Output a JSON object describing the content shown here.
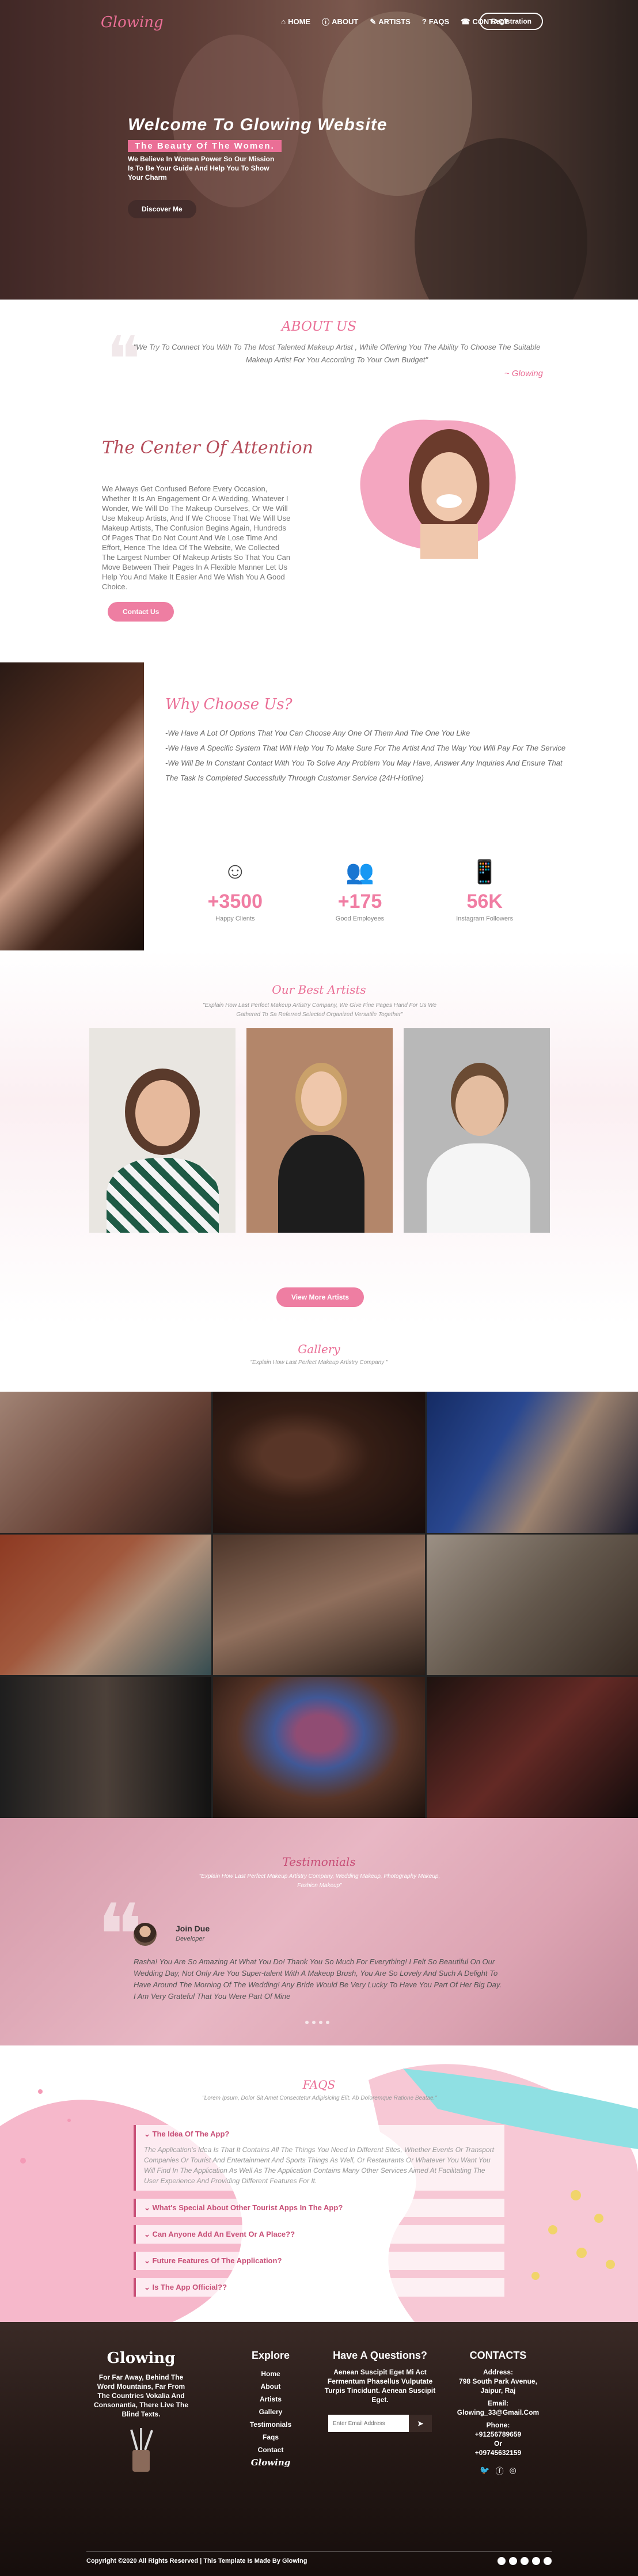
{
  "nav": {
    "logo": "Glowing",
    "items": [
      {
        "icon": "home-icon",
        "glyph": "⌂",
        "label": "HOME"
      },
      {
        "icon": "info-icon",
        "glyph": "ⓘ",
        "label": "ABOUT"
      },
      {
        "icon": "brush-icon",
        "glyph": "✎",
        "label": "ARTISTS"
      },
      {
        "icon": "question-icon",
        "glyph": "?",
        "label": "FAQS"
      },
      {
        "icon": "contact-icon",
        "glyph": "☎",
        "label": "CONTACT"
      }
    ],
    "registration": "Registration"
  },
  "hero": {
    "title": "Welcome To Glowing Website",
    "tagline": "The Beauty Of The Women.",
    "subtitle": "We Believe In Women Power So Our Mission Is To Be Your Guide And Help You To Show Your Charm",
    "button": "Discover Me"
  },
  "about": {
    "title": "ABOUT US",
    "quote": "\"We Try To Connect You With To The Most Talented Makeup Artist , While Offering You The Ability To Choose The Suitable Makeup Artist For You According To Your Own Budget\"",
    "quote_by": "~ Glowing"
  },
  "center": {
    "title": "The Center Of Attention",
    "text": "We Always Get Confused Before Every Occasion, Whether It Is An Engagement Or A Wedding, Whatever I Wonder, We Will Do The Makeup Ourselves, Or We Will Use Makeup Artists, And If We Choose That We Will Use Makeup Artists, The Confusion Begins Again, Hundreds Of Pages That Do Not Count And We Lose Time And Effort, Hence The Idea Of The Website, We Collected The Largest Number Of Makeup Artists So That You Can Move Between Their Pages In A Flexible Manner Let Us Help You And Make It Easier And We Wish You A Good Choice.",
    "button": "Contact Us"
  },
  "why": {
    "title": "Why Choose Us?",
    "points": [
      "-We Have A Lot Of Options That You Can Choose Any One Of Them And The One You Like",
      "-We Have A Specific System That Will Help You To Make Sure For The Artist And The Way You Will Pay For The Service",
      "-We Will Be In Constant Contact With You To Solve Any Problem You May Have, Answer Any Inquiries And Ensure That The Task Is Completed Successfully Through Customer Service (24H-Hotline)"
    ],
    "stats": [
      {
        "icon": "happy-clients-icon",
        "glyph": "☺",
        "value": "+3500",
        "label": "Happy Clients"
      },
      {
        "icon": "employees-icon",
        "glyph": "👥",
        "value": "+175",
        "label": "Good Employees"
      },
      {
        "icon": "instagram-icon",
        "glyph": "📱",
        "value": "56K",
        "label": "Instagram Followers"
      }
    ]
  },
  "artists": {
    "title": "Our Best Artists",
    "subtitle": "\"Explain How Last Perfect Makeup Artistry Company, We Give Fine Pages Hand For Us We Gathered To Sa Referred Selected Organized Versatile Together\"",
    "button": "View More Artists"
  },
  "gallery": {
    "title": "Gallery",
    "subtitle": "\"Explain How Last Perfect Makeup Artistry Company \""
  },
  "testimonials": {
    "title": "Testimonials",
    "subtitle": "\"Explain How Last Perfect Makeup Artistry Company, Wedding Makeup, Photography Makeup, Fashion Makeup\"",
    "name": "Join Due",
    "role": "Developer",
    "text": "Rasha! You Are So Amazing At What You Do! Thank You So Much For Everything! I Felt So Beautiful On Our Wedding Day, Not Only Are You Super-talent With A Makeup Brush, You Are So Lovely And Such A Delight To Have Around The Morning Of The Wedding! Any Bride Would Be Very Lucky To Have You Part Of Her Big Day. I Am Very Grateful That You Were Part Of Mine"
  },
  "faq": {
    "title": "FAQS",
    "subtitle": "\"Lorem Ipsum, Dolor Sit Amet Consectetur Adipisicing Elit. Ab Doloremque Ratione Beatae.\"",
    "items": [
      {
        "q": "The Idea Of The App?",
        "a": "The Application's Idea Is That It Contains All The Things You Need In Different Sites, Whether Events Or Transport Companies Or Tourist And Entertainment And Sports Things As Well, Or Restaurants Or Whatever You Want You Will Find In The Application As Well As The Application Contains Many Other Services Aimed At Facilitating The User Experience And Providing Different Features For It."
      },
      {
        "q": "What's Special About Other Tourist Apps In The App?",
        "a": ""
      },
      {
        "q": "Can Anyone Add An Event Or A Place??",
        "a": ""
      },
      {
        "q": "Future Features Of The Application?",
        "a": ""
      },
      {
        "q": "Is The App Official??",
        "a": ""
      }
    ]
  },
  "footer": {
    "brand": "Glowing",
    "brand_text": "For Far Away, Behind The Word Mountains, Far From The Countries Vokalia And Consonantia, There Live The Blind Texts.",
    "explore_title": "Explore",
    "explore": [
      "Home",
      "About",
      "Artists",
      "Gallery",
      "Testimonials",
      "Faqs",
      "Contact"
    ],
    "explore_logo": "Glowing",
    "question_title": "Have A Questions?",
    "question_text": "Aenean Suscipit Eget Mi Act Fermentum Phasellus Vulputate Turpis Tincidunt. Aenean Suscipit Eget.",
    "email_placeholder": "Enter Email Address",
    "contacts_title": "CONTACTS",
    "address_label": "Address:",
    "address": "798 South Park Avenue, Jaipur, Raj",
    "email_label": "Email:",
    "email": "Glowing_33@Gmail.Com",
    "phone_label": "Phone:",
    "phone1": "+91256789659",
    "or": "Or",
    "phone2": "+09745632159",
    "copyright": "Copyright ©2020 All Rights Reserved | This Template Is Made By Glowing"
  }
}
